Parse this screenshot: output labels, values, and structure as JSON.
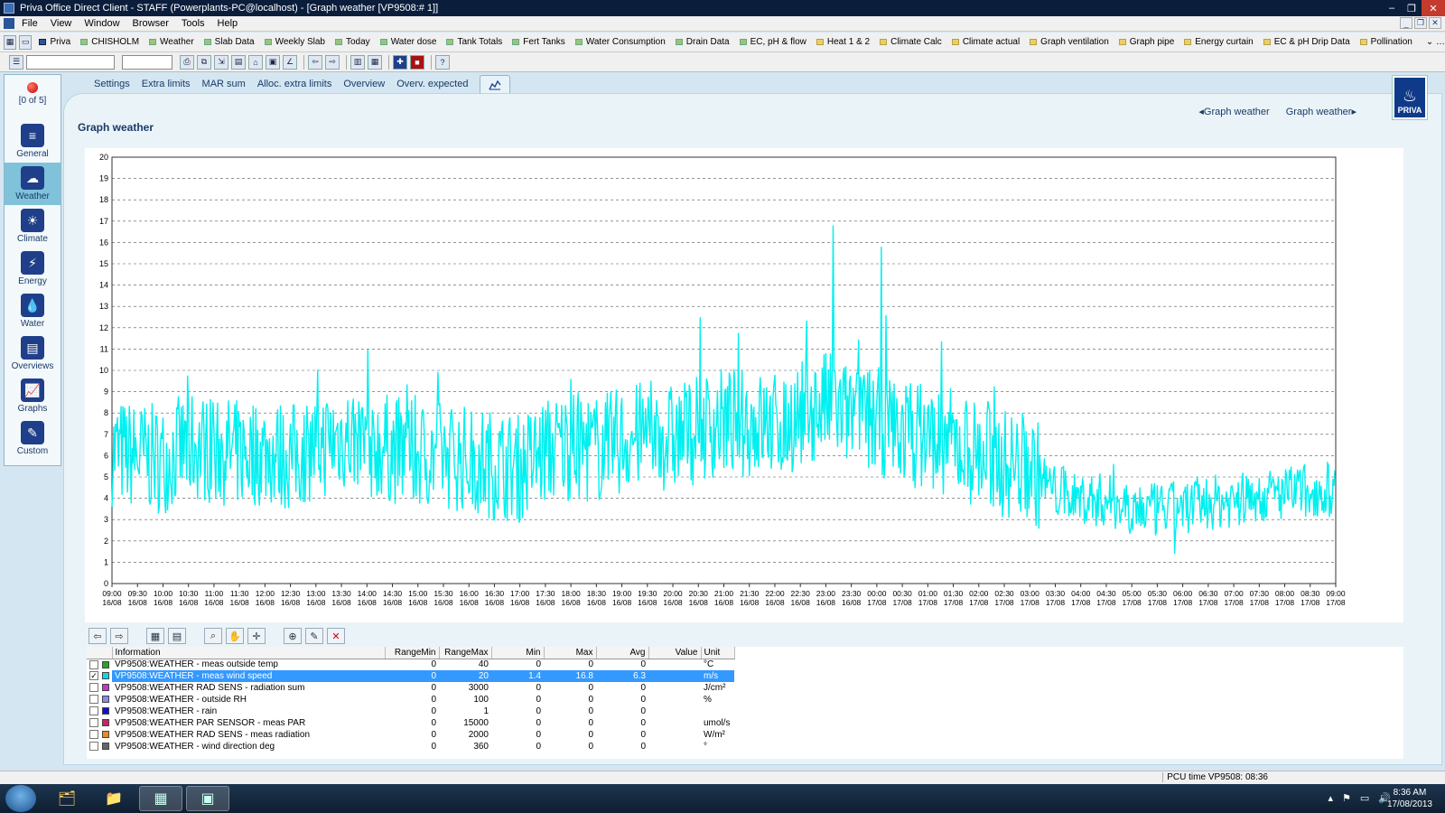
{
  "window": {
    "title": "Priva Office Direct Client - STAFF (Powerplants-PC@localhost) - [Graph weather [VP9508:# 1]]"
  },
  "menu": [
    "File",
    "View",
    "Window",
    "Browser",
    "Tools",
    "Help"
  ],
  "bookmarks": [
    {
      "label": "Priva",
      "color": "blue"
    },
    {
      "label": "CHISHOLM",
      "color": "green"
    },
    {
      "label": "Weather",
      "color": "green"
    },
    {
      "label": "Slab Data",
      "color": "green"
    },
    {
      "label": "Weekly Slab",
      "color": "green"
    },
    {
      "label": "Today",
      "color": "green"
    },
    {
      "label": "Water dose",
      "color": "green"
    },
    {
      "label": "Tank Totals",
      "color": "green"
    },
    {
      "label": "Fert Tanks",
      "color": "green"
    },
    {
      "label": "Water Consumption",
      "color": "green"
    },
    {
      "label": "Drain Data",
      "color": "green"
    },
    {
      "label": "EC, pH & flow",
      "color": "green"
    },
    {
      "label": "Heat 1 & 2",
      "color": "yellow"
    },
    {
      "label": "Climate Calc",
      "color": "yellow"
    },
    {
      "label": "Climate actual",
      "color": "yellow"
    },
    {
      "label": "Graph ventilation",
      "color": "yellow"
    },
    {
      "label": "Graph pipe",
      "color": "yellow"
    },
    {
      "label": "Energy curtain",
      "color": "yellow"
    },
    {
      "label": "EC & pH Drip Data",
      "color": "yellow"
    },
    {
      "label": "Pollination",
      "color": "yellow"
    }
  ],
  "alarm": {
    "count_label": "[0 of 5]"
  },
  "nav": [
    {
      "label": "General",
      "icon": "general-icon",
      "glyph": "≡",
      "active": false
    },
    {
      "label": "Weather",
      "icon": "weather-icon",
      "glyph": "☁",
      "active": true
    },
    {
      "label": "Climate",
      "icon": "climate-icon",
      "glyph": "☀",
      "active": false
    },
    {
      "label": "Energy",
      "icon": "energy-icon",
      "glyph": "⚡",
      "active": false
    },
    {
      "label": "Water",
      "icon": "water-icon",
      "glyph": "💧",
      "active": false
    },
    {
      "label": "Overviews",
      "icon": "overviews-icon",
      "glyph": "▤",
      "active": false
    },
    {
      "label": "Graphs",
      "icon": "graphs-icon",
      "glyph": "📈",
      "active": false
    },
    {
      "label": "Custom",
      "icon": "custom-icon",
      "glyph": "✎",
      "active": false
    }
  ],
  "tabs": [
    "Settings",
    "Extra limits",
    "MAR sum",
    "Alloc. extra limits",
    "Overview",
    "Overv. expected"
  ],
  "page": {
    "title": "Graph weather",
    "prev_link": "◂Graph weather",
    "next_link": "Graph weather▸",
    "logo_text": "PRIVA"
  },
  "chart_data": {
    "type": "line",
    "ylim": [
      0,
      20
    ],
    "yticks": [
      0,
      1,
      2,
      3,
      4,
      5,
      6,
      7,
      8,
      9,
      10,
      11,
      12,
      13,
      14,
      15,
      16,
      17,
      18,
      19,
      20
    ],
    "xticks": [
      {
        "time": "09:00",
        "date": "16/08"
      },
      {
        "time": "09:30",
        "date": "16/08"
      },
      {
        "time": "10:00",
        "date": "16/08"
      },
      {
        "time": "10:30",
        "date": "16/08"
      },
      {
        "time": "11:00",
        "date": "16/08"
      },
      {
        "time": "11:30",
        "date": "16/08"
      },
      {
        "time": "12:00",
        "date": "16/08"
      },
      {
        "time": "12:30",
        "date": "16/08"
      },
      {
        "time": "13:00",
        "date": "16/08"
      },
      {
        "time": "13:30",
        "date": "16/08"
      },
      {
        "time": "14:00",
        "date": "16/08"
      },
      {
        "time": "14:30",
        "date": "16/08"
      },
      {
        "time": "15:00",
        "date": "16/08"
      },
      {
        "time": "15:30",
        "date": "16/08"
      },
      {
        "time": "16:00",
        "date": "16/08"
      },
      {
        "time": "16:30",
        "date": "16/08"
      },
      {
        "time": "17:00",
        "date": "16/08"
      },
      {
        "time": "17:30",
        "date": "16/08"
      },
      {
        "time": "18:00",
        "date": "16/08"
      },
      {
        "time": "18:30",
        "date": "16/08"
      },
      {
        "time": "19:00",
        "date": "16/08"
      },
      {
        "time": "19:30",
        "date": "16/08"
      },
      {
        "time": "20:00",
        "date": "16/08"
      },
      {
        "time": "20:30",
        "date": "16/08"
      },
      {
        "time": "21:00",
        "date": "16/08"
      },
      {
        "time": "21:30",
        "date": "16/08"
      },
      {
        "time": "22:00",
        "date": "16/08"
      },
      {
        "time": "22:30",
        "date": "16/08"
      },
      {
        "time": "23:00",
        "date": "16/08"
      },
      {
        "time": "23:30",
        "date": "16/08"
      },
      {
        "time": "00:00",
        "date": "17/08"
      },
      {
        "time": "00:30",
        "date": "17/08"
      },
      {
        "time": "01:00",
        "date": "17/08"
      },
      {
        "time": "01:30",
        "date": "17/08"
      },
      {
        "time": "02:00",
        "date": "17/08"
      },
      {
        "time": "02:30",
        "date": "17/08"
      },
      {
        "time": "03:00",
        "date": "17/08"
      },
      {
        "time": "03:30",
        "date": "17/08"
      },
      {
        "time": "04:00",
        "date": "17/08"
      },
      {
        "time": "04:30",
        "date": "17/08"
      },
      {
        "time": "05:00",
        "date": "17/08"
      },
      {
        "time": "05:30",
        "date": "17/08"
      },
      {
        "time": "06:00",
        "date": "17/08"
      },
      {
        "time": "06:30",
        "date": "17/08"
      },
      {
        "time": "07:00",
        "date": "17/08"
      },
      {
        "time": "07:30",
        "date": "17/08"
      },
      {
        "time": "08:00",
        "date": "17/08"
      },
      {
        "time": "08:30",
        "date": "17/08"
      },
      {
        "time": "09:00",
        "date": "17/08"
      }
    ],
    "grid": true,
    "series": [
      {
        "color": "#00f0f0",
        "x": [
          "09:00",
          "09:30",
          "10:00",
          "10:30",
          "11:00",
          "11:30",
          "12:00",
          "12:30",
          "13:00",
          "13:30",
          "14:00",
          "14:30",
          "15:00",
          "15:30",
          "16:00",
          "16:30",
          "17:00",
          "17:30",
          "18:00",
          "18:30",
          "19:00",
          "19:30",
          "20:00",
          "20:30",
          "21:00",
          "21:30",
          "22:00",
          "22:30",
          "23:00",
          "23:30",
          "00:00",
          "00:30",
          "01:00",
          "01:30",
          "02:00",
          "02:30",
          "03:00",
          "03:30",
          "04:00",
          "04:30",
          "05:00",
          "05:30",
          "06:00",
          "06:30",
          "07:00",
          "07:30",
          "08:00",
          "08:30"
        ],
        "values": [
          6.2,
          6.0,
          5.8,
          6.5,
          6.3,
          6.1,
          6.2,
          5.9,
          6.4,
          6.9,
          6.6,
          6.3,
          6.0,
          6.1,
          5.8,
          5.6,
          5.4,
          6.2,
          6.5,
          6.3,
          6.7,
          7.0,
          6.8,
          7.3,
          7.6,
          7.5,
          7.4,
          7.9,
          8.4,
          7.8,
          7.6,
          7.2,
          6.9,
          6.6,
          6.1,
          5.6,
          5.5,
          4.3,
          4.0,
          3.9,
          3.6,
          3.4,
          3.6,
          3.8,
          3.9,
          4.1,
          4.2,
          4.4
        ],
        "min": 1.4,
        "max": 16.8
      }
    ]
  },
  "table": {
    "columns": [
      "Information",
      "RangeMin",
      "RangeMax",
      "Min",
      "Max",
      "Avg",
      "Value",
      "Unit"
    ],
    "rows": [
      {
        "checked": "",
        "swatch": "#22aa22",
        "info": "VP9508:WEATHER - meas outside temp",
        "rmin": "0",
        "rmax": "40",
        "min": "0",
        "max": "0",
        "avg": "0",
        "value": "",
        "unit": "°C",
        "selected": false
      },
      {
        "checked": "✓",
        "swatch": "#00e0e0",
        "info": "VP9508:WEATHER - meas wind speed",
        "rmin": "0",
        "rmax": "20",
        "min": "1.4",
        "max": "16.8",
        "avg": "6.3",
        "value": "",
        "unit": "m/s",
        "selected": true
      },
      {
        "checked": "",
        "swatch": "#cc33cc",
        "info": "VP9508:WEATHER RAD SENS - radiation sum",
        "rmin": "0",
        "rmax": "3000",
        "min": "0",
        "max": "0",
        "avg": "0",
        "value": "",
        "unit": "J/cm²",
        "selected": false
      },
      {
        "checked": "",
        "swatch": "#8888ee",
        "info": "VP9508:WEATHER - outside RH",
        "rmin": "0",
        "rmax": "100",
        "min": "0",
        "max": "0",
        "avg": "0",
        "value": "",
        "unit": "%",
        "selected": false
      },
      {
        "checked": "",
        "swatch": "#1010cc",
        "info": "VP9508:WEATHER - rain",
        "rmin": "0",
        "rmax": "1",
        "min": "0",
        "max": "0",
        "avg": "0",
        "value": "",
        "unit": "",
        "selected": false
      },
      {
        "checked": "",
        "swatch": "#cc2266",
        "info": "VP9508:WEATHER PAR SENSOR - meas PAR",
        "rmin": "0",
        "rmax": "15000",
        "min": "0",
        "max": "0",
        "avg": "0",
        "value": "",
        "unit": "umol/s",
        "selected": false
      },
      {
        "checked": "",
        "swatch": "#ee8822",
        "info": "VP9508:WEATHER RAD SENS - meas radiation",
        "rmin": "0",
        "rmax": "2000",
        "min": "0",
        "max": "0",
        "avg": "0",
        "value": "",
        "unit": "W/m²",
        "selected": false
      },
      {
        "checked": "",
        "swatch": "#666666",
        "info": "VP9508:WEATHER - wind direction deg",
        "rmin": "0",
        "rmax": "360",
        "min": "0",
        "max": "0",
        "avg": "0",
        "value": "",
        "unit": "°",
        "selected": false
      }
    ]
  },
  "status": {
    "pcu_time": "PCU time VP9508: 08:36"
  },
  "taskbar": {
    "time": "8:36 AM",
    "date": "17/08/2013"
  }
}
